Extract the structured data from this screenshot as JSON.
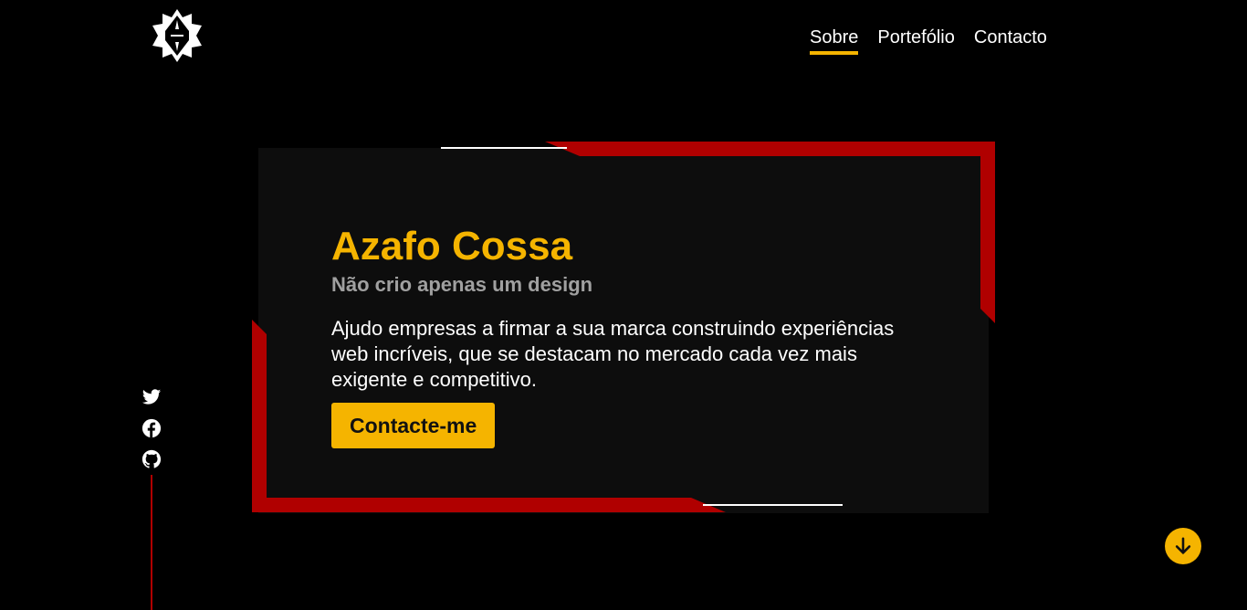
{
  "header": {
    "logo_icon": "geometric-star-logo",
    "nav": [
      {
        "label": "Sobre",
        "active": true
      },
      {
        "label": "Portefólio",
        "active": false
      },
      {
        "label": "Contacto",
        "active": false
      }
    ]
  },
  "hero": {
    "title": "Azafo Cossa",
    "subtitle": "Não crio apenas um design",
    "description": "Ajudo empresas a firmar a sua marca construindo experiências web incríveis, que se destacam no mercado cada vez mais exigente e competitivo.",
    "cta_label": "Contacte-me"
  },
  "social": {
    "items": [
      {
        "icon": "twitter-icon"
      },
      {
        "icon": "facebook-icon"
      },
      {
        "icon": "github-icon"
      }
    ]
  },
  "scroll": {
    "icon": "arrow-down-icon"
  },
  "colors": {
    "background": "#000000",
    "card": "#0d0d0d",
    "accent": "#f5b400",
    "frame_red": "#b00000",
    "subtitle": "#a0a0a0"
  }
}
